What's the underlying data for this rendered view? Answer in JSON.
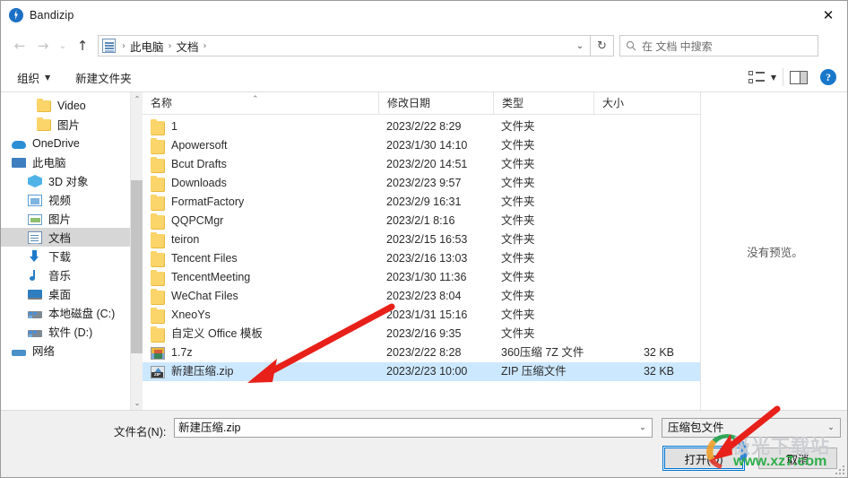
{
  "window": {
    "title": "Bandizip",
    "close_label": "✕"
  },
  "nav": {
    "back_icon": "←",
    "forward_icon": "→",
    "recent_icon": "⌄",
    "up_icon": "↑",
    "breadcrumb": [
      "此电脑",
      "文档"
    ],
    "breadcrumb_sep": "›",
    "dropdown_icon": "⌄",
    "refresh_icon": "↻"
  },
  "search": {
    "icon": "search-icon",
    "placeholder": "在 文档 中搜索"
  },
  "toolbar": {
    "organize_label": "组织",
    "organize_caret": "▼",
    "new_folder_label": "新建文件夹",
    "view_caret": "▼"
  },
  "sidebar": {
    "items": [
      {
        "label": "Video",
        "icon": "folder-icon",
        "indent": 2,
        "selected": false
      },
      {
        "label": "图片",
        "icon": "folder-icon",
        "indent": 2,
        "selected": false
      },
      {
        "label": "OneDrive",
        "icon": "cloud-icon",
        "indent": 0,
        "selected": false
      },
      {
        "label": "此电脑",
        "icon": "monitor-icon",
        "indent": 0,
        "selected": false
      },
      {
        "label": "3D 对象",
        "icon": "3d-object-icon",
        "indent": 1,
        "selected": false
      },
      {
        "label": "视频",
        "icon": "video-icon",
        "indent": 1,
        "selected": false
      },
      {
        "label": "图片",
        "icon": "picture-icon",
        "indent": 1,
        "selected": false
      },
      {
        "label": "文档",
        "icon": "document-icon",
        "indent": 1,
        "selected": true
      },
      {
        "label": "下载",
        "icon": "download-icon",
        "indent": 1,
        "selected": false
      },
      {
        "label": "音乐",
        "icon": "music-icon",
        "indent": 1,
        "selected": false
      },
      {
        "label": "桌面",
        "icon": "desktop-icon",
        "indent": 1,
        "selected": false
      },
      {
        "label": "本地磁盘 (C:)",
        "icon": "disk-icon",
        "indent": 1,
        "selected": false
      },
      {
        "label": "软件 (D:)",
        "icon": "disk-icon",
        "indent": 1,
        "selected": false
      },
      {
        "label": "网络",
        "icon": "network-icon",
        "indent": 0,
        "selected": false
      }
    ],
    "scroll_up_icon": "⌃",
    "scroll_down_icon": "⌄"
  },
  "filelist": {
    "columns": [
      "名称",
      "修改日期",
      "类型",
      "大小"
    ],
    "sort_indicator": "⌃",
    "rows": [
      {
        "name": "1",
        "date": "2023/2/22 8:29",
        "type": "文件夹",
        "size": "",
        "icon": "folder-icon",
        "selected": false
      },
      {
        "name": "Apowersoft",
        "date": "2023/1/30 14:10",
        "type": "文件夹",
        "size": "",
        "icon": "folder-icon",
        "selected": false
      },
      {
        "name": "Bcut Drafts",
        "date": "2023/2/20 14:51",
        "type": "文件夹",
        "size": "",
        "icon": "folder-icon",
        "selected": false
      },
      {
        "name": "Downloads",
        "date": "2023/2/23 9:57",
        "type": "文件夹",
        "size": "",
        "icon": "folder-icon",
        "selected": false
      },
      {
        "name": "FormatFactory",
        "date": "2023/2/9 16:31",
        "type": "文件夹",
        "size": "",
        "icon": "folder-icon",
        "selected": false
      },
      {
        "name": "QQPCMgr",
        "date": "2023/2/1 8:16",
        "type": "文件夹",
        "size": "",
        "icon": "folder-icon",
        "selected": false
      },
      {
        "name": "teiron",
        "date": "2023/2/15 16:53",
        "type": "文件夹",
        "size": "",
        "icon": "folder-icon",
        "selected": false
      },
      {
        "name": "Tencent Files",
        "date": "2023/2/16 13:03",
        "type": "文件夹",
        "size": "",
        "icon": "folder-icon",
        "selected": false
      },
      {
        "name": "TencentMeeting",
        "date": "2023/1/30 11:36",
        "type": "文件夹",
        "size": "",
        "icon": "folder-icon",
        "selected": false
      },
      {
        "name": "WeChat Files",
        "date": "2023/2/23 8:04",
        "type": "文件夹",
        "size": "",
        "icon": "folder-icon",
        "selected": false
      },
      {
        "name": "XneoYs",
        "date": "2023/1/31 15:16",
        "type": "文件夹",
        "size": "",
        "icon": "folder-icon",
        "selected": false
      },
      {
        "name": "自定义 Office 模板",
        "date": "2023/2/16 9:35",
        "type": "文件夹",
        "size": "",
        "icon": "folder-icon",
        "selected": false
      },
      {
        "name": "1.7z",
        "date": "2023/2/22 8:28",
        "type": "360压缩 7Z 文件",
        "size": "32 KB",
        "icon": "sevenzip-file-icon",
        "selected": false
      },
      {
        "name": "新建压缩.zip",
        "date": "2023/2/23 10:00",
        "type": "ZIP 压缩文件",
        "size": "32 KB",
        "icon": "zip-file-icon",
        "selected": true
      }
    ]
  },
  "preview": {
    "empty_text": "没有预览。"
  },
  "footer": {
    "filename_label": "文件名(N):",
    "filename_value": "新建压缩.zip",
    "filename_dropdown_icon": "⌄",
    "filetype_value": "压缩包文件",
    "filetype_dropdown_icon": "⌄",
    "open_button": "打开(O)",
    "cancel_button": "取消"
  },
  "watermark": {
    "cn_text": "极光下载站",
    "url_text": "www.xz7.com"
  },
  "colors": {
    "selection": "#cce8ff",
    "accent": "#0078d7",
    "annotation_arrow": "#e8201a",
    "watermark_green": "#2fae4a"
  }
}
